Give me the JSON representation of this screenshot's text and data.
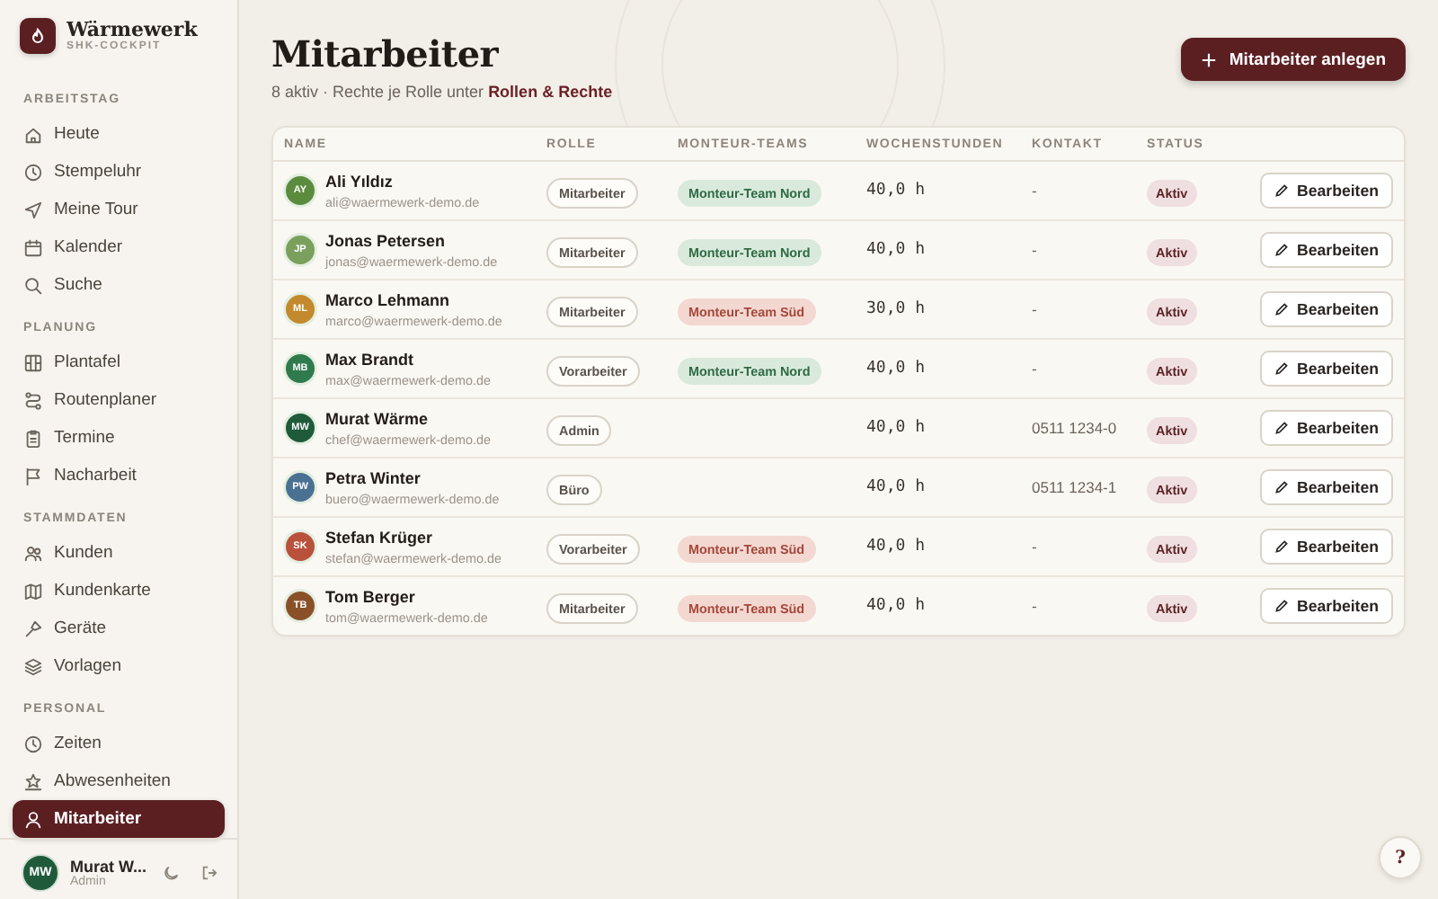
{
  "brand": {
    "name": "Wärmewerk",
    "tagline": "SHK-COCKPIT"
  },
  "sidebar": {
    "sections": [
      {
        "title": "ARBEITSTAG",
        "items": [
          {
            "label": "Heute",
            "selected": false
          },
          {
            "label": "Stempeluhr",
            "selected": false
          },
          {
            "label": "Meine Tour",
            "selected": false
          },
          {
            "label": "Kalender",
            "selected": false
          },
          {
            "label": "Suche",
            "selected": false
          }
        ]
      },
      {
        "title": "PLANUNG",
        "items": [
          {
            "label": "Plantafel",
            "selected": false
          },
          {
            "label": "Routenplaner",
            "selected": false
          },
          {
            "label": "Termine",
            "selected": false
          },
          {
            "label": "Nacharbeit",
            "selected": false
          }
        ]
      },
      {
        "title": "STAMMDATEN",
        "items": [
          {
            "label": "Kunden",
            "selected": false
          },
          {
            "label": "Kundenkarte",
            "selected": false
          },
          {
            "label": "Geräte",
            "selected": false
          },
          {
            "label": "Vorlagen",
            "selected": false
          }
        ]
      },
      {
        "title": "PERSONAL",
        "items": [
          {
            "label": "Zeiten",
            "selected": false
          },
          {
            "label": "Abwesenheiten",
            "selected": false
          },
          {
            "label": "Mitarbeiter",
            "selected": true
          }
        ]
      }
    ],
    "user": {
      "initials": "MW",
      "name": "Murat W...",
      "role": "Admin"
    }
  },
  "header": {
    "title": "Mitarbeiter",
    "subtitle": "8 aktiv · Rechte je Rolle unter",
    "subtitle_link": "Rollen & Rechte",
    "add_button": "Mitarbeiter anlegen"
  },
  "table": {
    "columns": [
      "NAME",
      "ROLLE",
      "MONTEUR-TEAMS",
      "WOCHENSTUNDEN",
      "KONTAKT",
      "STATUS"
    ],
    "rows": [
      {
        "initials": "AY",
        "color": "#5b8c3e",
        "name": "Ali Yıldız",
        "email": "ali@waermewerk-demo.de",
        "role": "Mitarbeiter",
        "team": {
          "label": "Monteur-Team Nord",
          "kind": "nord"
        },
        "hours": "40,0 h",
        "contact": "-",
        "status": "Aktiv",
        "action": "Bearbeiten"
      },
      {
        "initials": "JP",
        "color": "#7ba05e",
        "name": "Jonas Petersen",
        "email": "jonas@waermewerk-demo.de",
        "role": "Mitarbeiter",
        "team": {
          "label": "Monteur-Team Nord",
          "kind": "nord"
        },
        "hours": "40,0 h",
        "contact": "-",
        "status": "Aktiv",
        "action": "Bearbeiten"
      },
      {
        "initials": "ML",
        "color": "#c28a2c",
        "name": "Marco Lehmann",
        "email": "marco@waermewerk-demo.de",
        "role": "Mitarbeiter",
        "team": {
          "label": "Monteur-Team Süd",
          "kind": "sued"
        },
        "hours": "30,0 h",
        "contact": "-",
        "status": "Aktiv",
        "action": "Bearbeiten"
      },
      {
        "initials": "MB",
        "color": "#2f7b4d",
        "name": "Max Brandt",
        "email": "max@waermewerk-demo.de",
        "role": "Vorarbeiter",
        "team": {
          "label": "Monteur-Team Nord",
          "kind": "nord"
        },
        "hours": "40,0 h",
        "contact": "-",
        "status": "Aktiv",
        "action": "Bearbeiten"
      },
      {
        "initials": "MW",
        "color": "#1f5a3b",
        "name": "Murat Wärme",
        "email": "chef@waermewerk-demo.de",
        "role": "Admin",
        "hours": "40,0 h",
        "contact": "0511 1234-0",
        "status": "Aktiv",
        "action": "Bearbeiten"
      },
      {
        "initials": "PW",
        "color": "#4b7192",
        "name": "Petra Winter",
        "email": "buero@waermewerk-demo.de",
        "role": "Büro",
        "hours": "40,0 h",
        "contact": "0511 1234-1",
        "status": "Aktiv",
        "action": "Bearbeiten"
      },
      {
        "initials": "SK",
        "color": "#b9513b",
        "name": "Stefan Krüger",
        "email": "stefan@waermewerk-demo.de",
        "role": "Vorarbeiter",
        "team": {
          "label": "Monteur-Team Süd",
          "kind": "sued"
        },
        "hours": "40,0 h",
        "contact": "-",
        "status": "Aktiv",
        "action": "Bearbeiten"
      },
      {
        "initials": "TB",
        "color": "#8a5129",
        "name": "Tom Berger",
        "email": "tom@waermewerk-demo.de",
        "role": "Mitarbeiter",
        "team": {
          "label": "Monteur-Team Süd",
          "kind": "sued"
        },
        "hours": "40,0 h",
        "contact": "-",
        "status": "Aktiv",
        "action": "Bearbeiten"
      }
    ]
  },
  "help": "?"
}
